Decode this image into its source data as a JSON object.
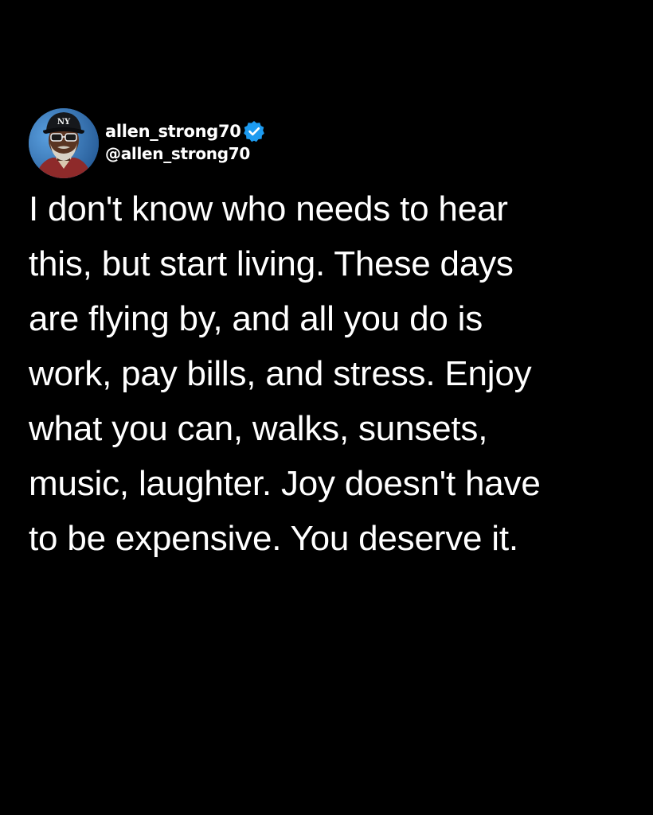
{
  "post": {
    "author": {
      "display_name": "allen_strong70",
      "handle": "@allen_strong70",
      "verified_icon": "verified-badge-icon",
      "verified_color": "#1d9bf0",
      "avatar_icon": "avatar-photo"
    },
    "text": "I don't know who needs to hear\nthis, but start living. These days\nare flying by, and all you do is\nwork, pay bills, and stress. Enjoy\nwhat you can, walks, sunsets,\nmusic, laughter. Joy doesn't have\nto be expensive. You deserve it."
  },
  "colors": {
    "background": "#000000",
    "text": "#ffffff"
  }
}
